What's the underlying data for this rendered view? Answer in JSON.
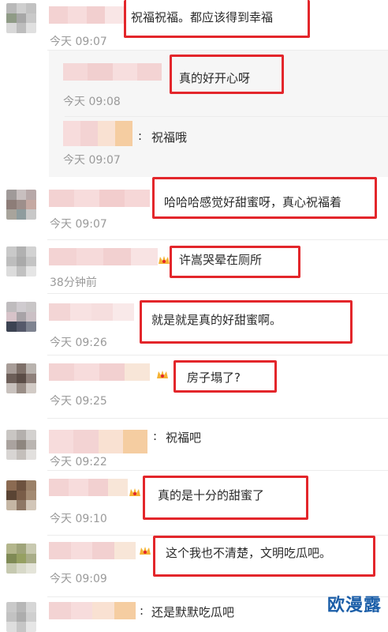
{
  "comments": [
    {
      "text": "祝福祝福。都应该得到幸福",
      "time": "今天 09:07"
    },
    {
      "text": "真的好开心呀",
      "time": "今天 09:08"
    },
    {
      "text": "祝福哦",
      "time": "今天 09:07"
    },
    {
      "text": "哈哈哈感觉好甜蜜呀，真心祝福着",
      "time": "今天 09:07"
    },
    {
      "text": "许嵩哭晕在厕所",
      "time": "38分钟前"
    },
    {
      "text": "就是就是真的好甜蜜啊。",
      "time": "今天 09:26"
    },
    {
      "text": "房子塌了?",
      "time": "今天 09:25"
    },
    {
      "text": "祝福吧",
      "time": "今天 09:22"
    },
    {
      "text": "真的是十分的甜蜜了",
      "time": "今天 09:10"
    },
    {
      "text": "这个我也不清楚，文明吃瓜吧。",
      "time": "今天 09:09"
    },
    {
      "text": "还是默默吃瓜吧",
      "time": ""
    }
  ],
  "watermark": "欧漫露",
  "colors": {
    "highlight": "#e3262b",
    "timestamp": "#9a9a9a",
    "reply_bg": "#f6f6f6",
    "watermark": "#1b5ea8"
  }
}
